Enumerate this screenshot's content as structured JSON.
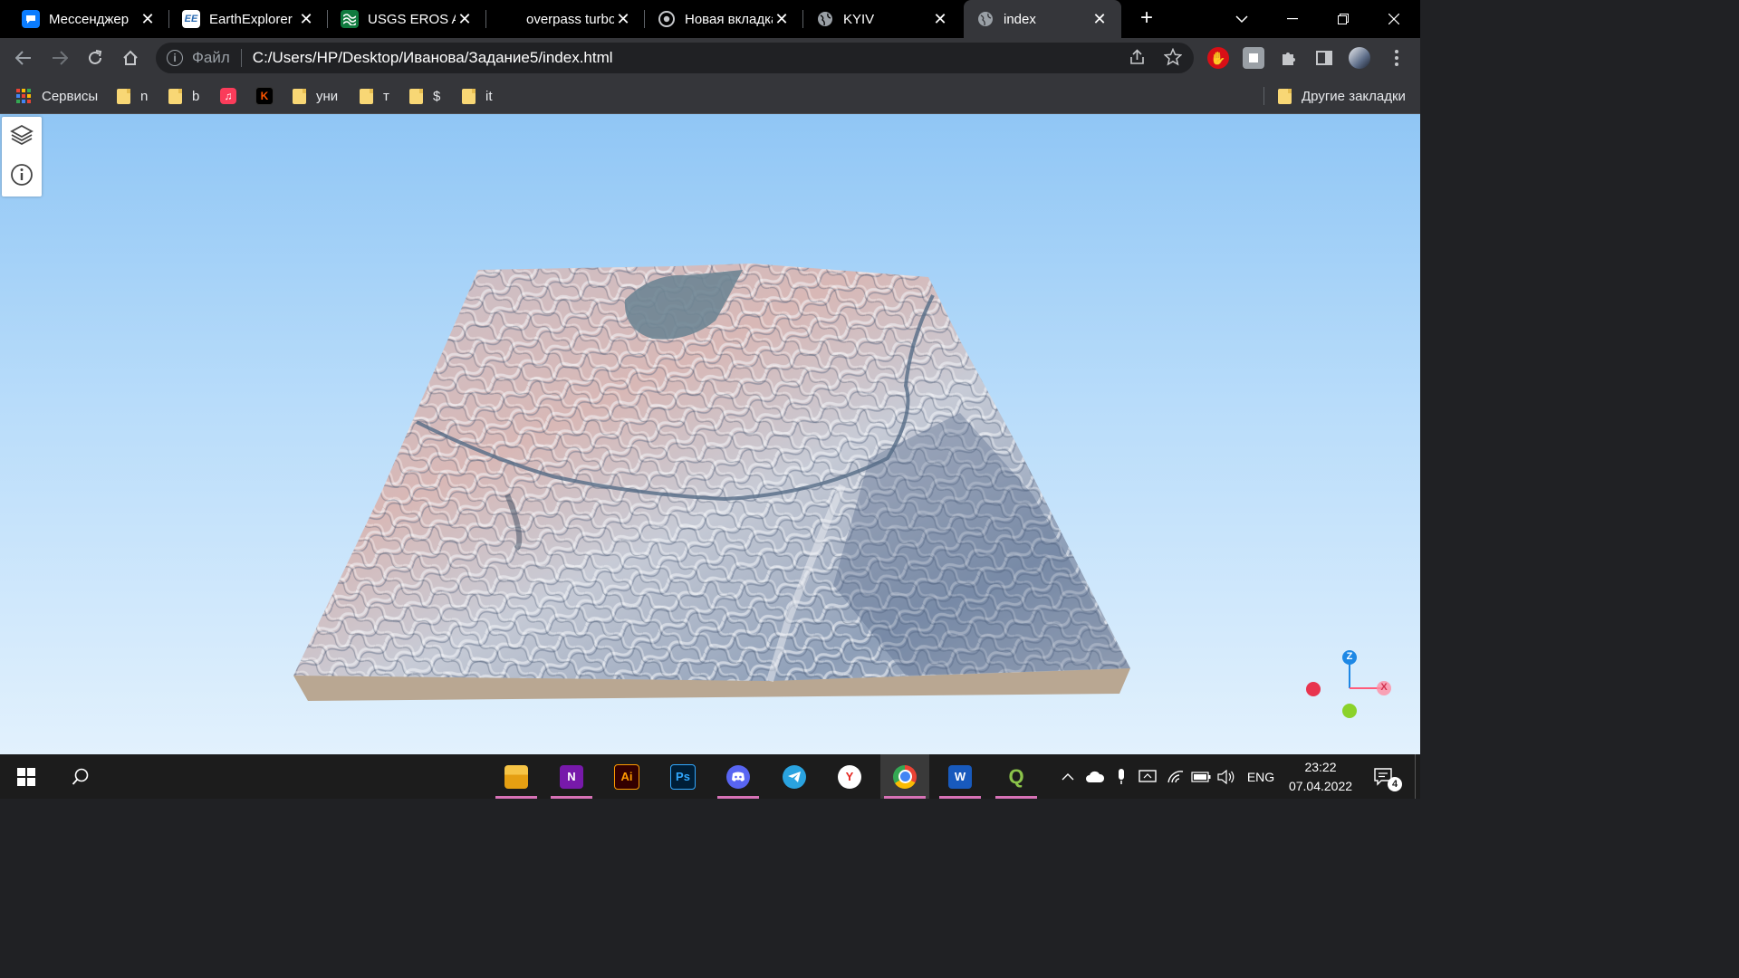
{
  "browser": {
    "tabs": [
      {
        "title": "Мессенджер",
        "favicon": "messenger-icon",
        "color": "#0a7cff",
        "glyph": "💬"
      },
      {
        "title": "EarthExplorer",
        "favicon": "earthexplorer-icon",
        "color": "#ffffff",
        "glyph": "EE"
      },
      {
        "title": "USGS EROS Ar",
        "favicon": "usgs-icon",
        "color": "#0f7a3e",
        "glyph": "≋"
      },
      {
        "title": "overpass turbo",
        "favicon": "overpass-icon",
        "color": "#000000",
        "glyph": ""
      },
      {
        "title": "Новая вкладка",
        "favicon": "chrome-icon",
        "color": "#9aa0a6",
        "glyph": "◎"
      },
      {
        "title": "KYIV",
        "favicon": "globe-icon",
        "color": "#9aa0a6",
        "glyph": "🌐"
      },
      {
        "title": "index",
        "favicon": "globe-icon",
        "color": "#9aa0a6",
        "glyph": "🌐"
      }
    ],
    "active_tab_index": 6,
    "new_tab_label": "+",
    "omnibox": {
      "security_label": "Файл",
      "url": "C:/Users/HP/Desktop/Иванова/Задание5/index.html"
    },
    "bookmarks": [
      {
        "label": "Сервисы",
        "kind": "apps"
      },
      {
        "label": "n",
        "kind": "folder"
      },
      {
        "label": "b",
        "kind": "folder"
      },
      {
        "label": "",
        "kind": "music"
      },
      {
        "label": "",
        "kind": "kinopoisk"
      },
      {
        "label": "уни",
        "kind": "folder"
      },
      {
        "label": "т",
        "kind": "folder"
      },
      {
        "label": "$",
        "kind": "folder"
      },
      {
        "label": "it",
        "kind": "folder"
      }
    ],
    "other_bookmarks_label": "Другие закладки"
  },
  "viewer": {
    "panel_buttons": [
      "layers-icon",
      "info-icon"
    ],
    "axis_labels": {
      "z": "Z",
      "x": "X"
    },
    "colors": {
      "z": "#1e88e5",
      "x": "#ff5c7a",
      "y": "#8bd22a",
      "neg_x": "#e8344e"
    }
  },
  "taskbar": {
    "apps": [
      {
        "name": "file-explorer",
        "color": "#f2b01e",
        "glyph": "▬",
        "running": true
      },
      {
        "name": "onenote",
        "color": "#7719aa",
        "glyph": "N",
        "running": true
      },
      {
        "name": "illustrator",
        "color": "#2d1a00",
        "glyph": "Ai",
        "running": false
      },
      {
        "name": "photoshop",
        "color": "#001e36",
        "glyph": "Ps",
        "running": false
      },
      {
        "name": "discord",
        "color": "#5865f2",
        "glyph": "◉",
        "running": true
      },
      {
        "name": "telegram",
        "color": "#2aa3e0",
        "glyph": "➤",
        "running": false
      },
      {
        "name": "yandex",
        "color": "#ffffff",
        "glyph": "Y",
        "running": false
      },
      {
        "name": "chrome",
        "color": "#ffffff",
        "glyph": "◎",
        "running": true
      },
      {
        "name": "word",
        "color": "#185abd",
        "glyph": "W",
        "running": true
      },
      {
        "name": "qgis",
        "color": "#589632",
        "glyph": "Q",
        "running": true
      }
    ],
    "language": "ENG",
    "time": "23:22",
    "date": "07.04.2022",
    "notifications": "4"
  }
}
